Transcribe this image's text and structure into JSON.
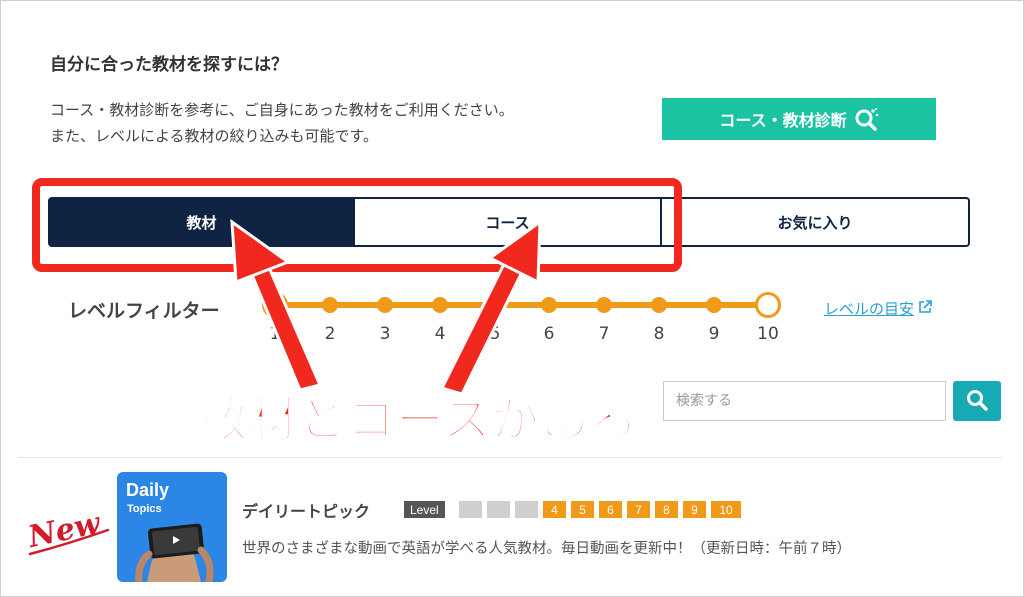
{
  "heading": "自分に合った教材を探すには？",
  "description": {
    "line1": "コース・教材診断を参考に、ご自身にあった教材をご利用ください。",
    "line2": "また、レベルによる教材の絞り込みも可能です。"
  },
  "diagnosis_button": {
    "label": "コース・教材診断",
    "icon": "search-icon"
  },
  "tabs": [
    {
      "label": "教材",
      "active": true
    },
    {
      "label": "コース",
      "active": false
    },
    {
      "label": "お気に入り",
      "active": false
    }
  ],
  "level_filter": {
    "label": "レベルフィルター",
    "levels": [
      "1",
      "2",
      "3",
      "4",
      "5",
      "6",
      "7",
      "8",
      "9",
      "10"
    ],
    "guide_link": "レベルの目安",
    "guide_icon": "external-link-icon",
    "color": "#f09a1a"
  },
  "annotation": "教材とコースがある",
  "search": {
    "placeholder": "検索する",
    "button_icon": "search-icon"
  },
  "materials": [
    {
      "badge": "New",
      "thumb_title": "Daily",
      "thumb_subtitle": "Topics",
      "title": "デイリートピック",
      "level_label": "Level",
      "levels_off": [
        "",
        "",
        ""
      ],
      "levels_on": [
        "4",
        "5",
        "6",
        "7",
        "8",
        "9",
        "10"
      ],
      "description": "世界のさまざまな動画で英語が学べる人気教材。毎日動画を更新中！（更新日時：午前７時）"
    }
  ],
  "colors": {
    "accent": "#1bc3a3",
    "navy": "#0e2442",
    "annotation": "#f0281e",
    "search_button": "#17a9b4"
  }
}
